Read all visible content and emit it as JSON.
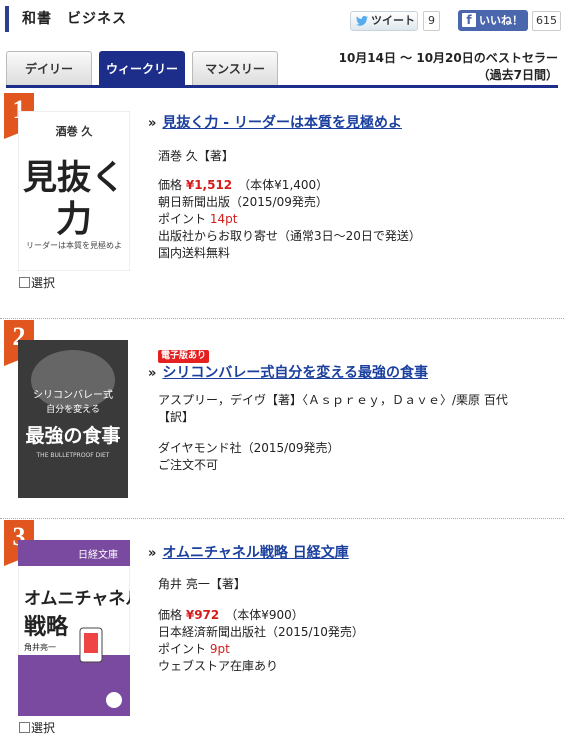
{
  "header": {
    "title": "和書　ビジネス",
    "tweet_label": "ツイート",
    "tweet_count": "9",
    "like_label": "いいね！",
    "like_count": "615"
  },
  "tabs": [
    {
      "label": "デイリー",
      "active": false
    },
    {
      "label": "ウィークリー",
      "active": true
    },
    {
      "label": "マンスリー",
      "active": false
    }
  ],
  "period": {
    "line1": "10月14日 〜 10月20日のベストセラー",
    "line2": "（過去7日間）"
  },
  "items": [
    {
      "rank": "1",
      "cover": {
        "author": "酒巻 久",
        "title1": "見抜く",
        "title2": "力",
        "subtitle": "リーダーは本質を見極めよ"
      },
      "title": "見抜く力 - リーダーは本質を見極めよ",
      "author": "酒巻 久【著】",
      "price_label": "価格",
      "price": "¥1,512",
      "price_base": "（本体¥1,400）",
      "publisher": "朝日新聞出版（2015/09発売）",
      "point_label": "ポイント",
      "point": "14pt",
      "stock": "出版社からお取り寄せ（通常3日〜20日で発送）",
      "shipping": "国内送料無料",
      "select_label": "選択"
    },
    {
      "rank": "2",
      "ebook_badge": "電子版あり",
      "cover": {
        "title1": "シリコンバレー式",
        "title2": "自分を変える",
        "title3": "最強の食事",
        "subtitle": "THE BULLETPROOF DIET"
      },
      "title": "シリコンバレー式自分を変える最強の食事",
      "author1": "アスプリー，デイヴ【著】〈Ａｓｐｒｅｙ，Ｄａｖｅ〉/栗原 百代",
      "author2": "【訳】",
      "publisher": "ダイヤモンド社（2015/09発売）",
      "stock": "ご注文不可"
    },
    {
      "rank": "3",
      "cover": {
        "label": "日経文庫",
        "title1": "オムニチャネル",
        "title2": "戦略",
        "author": "角井亮一"
      },
      "title": "オムニチャネル戦略 日経文庫",
      "author": "角井 亮一【著】",
      "price_label": "価格",
      "price": "¥972",
      "price_base": "（本体¥900）",
      "publisher": "日本経済新聞出版社（2015/10発売）",
      "point_label": "ポイント",
      "point": "9pt",
      "stock": "ウェブストア在庫あり",
      "select_label": "選択"
    }
  ]
}
